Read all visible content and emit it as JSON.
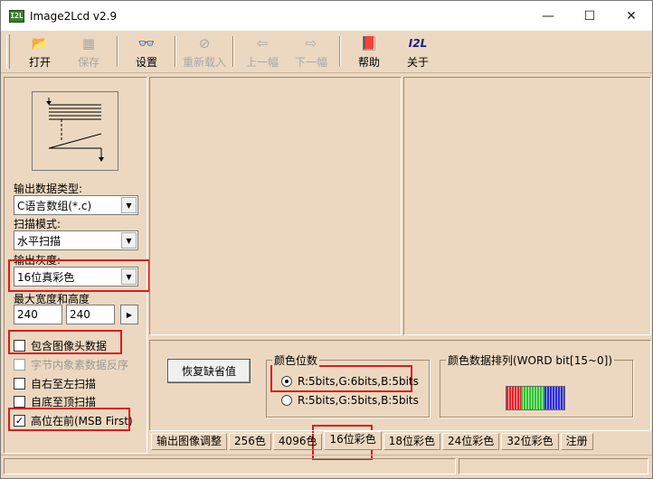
{
  "window": {
    "title": "Image2Lcd v2.9",
    "icon_text": "I2L"
  },
  "toolbar": {
    "items": [
      {
        "label": "打开",
        "icon": "open-folder-icon",
        "glyph": "📂",
        "enabled": true
      },
      {
        "label": "保存",
        "icon": "save-disk-icon",
        "glyph": "▦",
        "enabled": false
      },
      {
        "label": "设置",
        "icon": "settings-glasses-icon",
        "glyph": "👓",
        "enabled": true
      },
      {
        "label": "重新载入",
        "icon": "reload-icon",
        "glyph": "⊘",
        "enabled": false
      },
      {
        "label": "上一幅",
        "icon": "previous-image-icon",
        "glyph": "⇦",
        "enabled": false
      },
      {
        "label": "下一幅",
        "icon": "next-image-icon",
        "glyph": "⇨",
        "enabled": false
      },
      {
        "label": "帮助",
        "icon": "help-book-icon",
        "glyph": "📕",
        "enabled": true
      },
      {
        "label": "关于",
        "icon": "about-i2l-icon",
        "glyph": "I2L",
        "enabled": true
      }
    ]
  },
  "left": {
    "output_type_label": "输出数据类型:",
    "output_type_value": "C语言数组(*.c)",
    "scan_mode_label": "扫描模式:",
    "scan_mode_value": "水平扫描",
    "gray_label": "输出灰度:",
    "gray_value": "16位真彩色",
    "size_label": "最大宽度和高度",
    "width": "240",
    "height": "240",
    "size_button": "▶",
    "checkboxes": [
      {
        "label": "包含图像头数据",
        "checked": false,
        "enabled": true
      },
      {
        "label": "字节内象素数据反序",
        "checked": false,
        "enabled": false
      },
      {
        "label": "自右至左扫描",
        "checked": false,
        "enabled": true
      },
      {
        "label": "自底至顶扫描",
        "checked": false,
        "enabled": true
      },
      {
        "label": "高位在前(MSB First)",
        "checked": true,
        "enabled": true
      }
    ]
  },
  "options": {
    "restore_button": "恢复缺省值",
    "bits_group_title": "颜色位数",
    "bits_options": [
      {
        "label": "R:5bits,G:6bits,B:5bits",
        "selected": true
      },
      {
        "label": "R:5bits,G:5bits,B:5bits",
        "selected": false
      }
    ],
    "order_group_title": "颜色数据排列(WORD bit[15~0])"
  },
  "tabs": [
    "输出图像调整",
    "256色",
    "4096色",
    "16位彩色",
    "18位彩色",
    "24位彩色",
    "32位彩色",
    "注册"
  ],
  "active_tab": "16位彩色",
  "colors": {
    "highlight": "#e0191b",
    "panel_bg": "#ecd8c0",
    "red": "#e8202a",
    "green": "#2ec42e",
    "blue": "#2a2adc"
  }
}
